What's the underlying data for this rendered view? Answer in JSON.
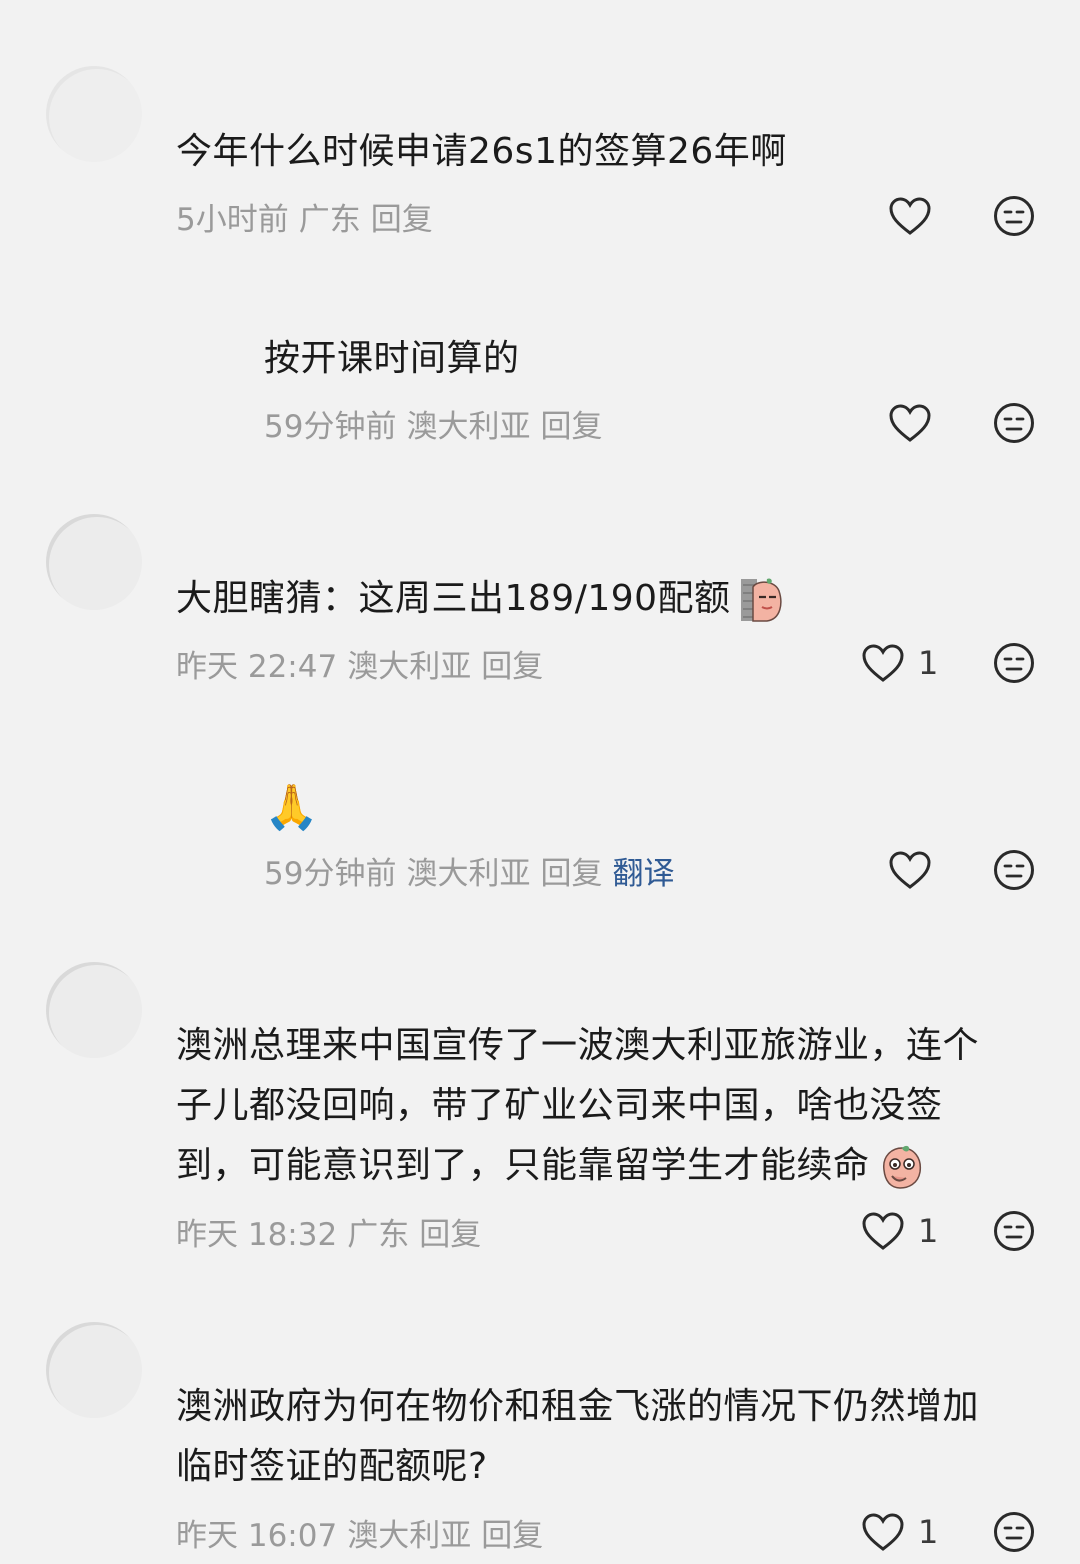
{
  "comments": [
    {
      "text": "今年什么时候申请26s1的签算26年啊",
      "time": "5小时前",
      "location": "广东",
      "reply": "回复",
      "likes": null
    },
    {
      "text": "按开课时间算的",
      "time": "59分钟前",
      "location": "澳大利亚",
      "reply": "回复",
      "likes": null
    },
    {
      "text": "大胆瞎猜：这周三出189/190配额",
      "time": "昨天 22:47",
      "location": "澳大利亚",
      "reply": "回复",
      "likes": "1",
      "emoji": "peeking-peach-sticker"
    },
    {
      "text": "🙏",
      "time": "59分钟前",
      "location": "澳大利亚",
      "reply": "回复",
      "translate": "翻译",
      "likes": null
    },
    {
      "lines": [
        "澳洲总理来中国宣传了一波澳大利亚旅游业，连个",
        "子儿都没回响，带了矿业公司来中国，啥也没签",
        "到，可能意识到了，只能靠留学生才能续命"
      ],
      "time": "昨天 18:32",
      "location": "广东",
      "reply": "回复",
      "likes": "1",
      "emoji": "thinking-peach-sticker"
    },
    {
      "lines": [
        "澳洲政府为何在物价和租金飞涨的情况下仍然增加",
        "临时签证的配额呢?"
      ],
      "time": "昨天 16:07",
      "location": "澳大利亚",
      "reply": "回复",
      "likes": "1"
    }
  ],
  "icons": {
    "like": "heart-outline-icon",
    "dislike": "meh-face-icon"
  },
  "colors": {
    "background": "#f2f2f2",
    "text": "#1b1b1b",
    "meta": "#9a9a9a",
    "translate": "#2f5a94"
  }
}
